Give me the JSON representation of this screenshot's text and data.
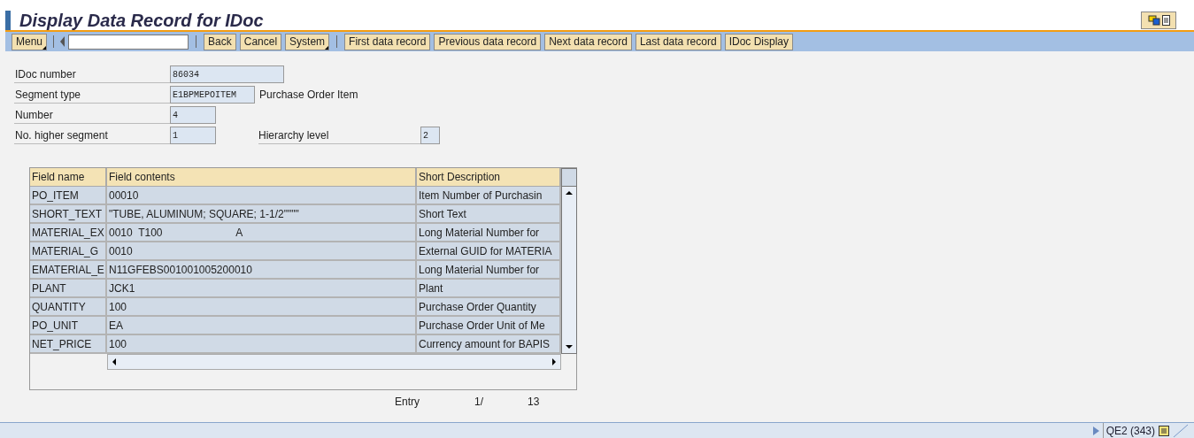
{
  "window": {
    "title": "Display Data Record for IDoc"
  },
  "toolbar": {
    "menu": "Menu",
    "buttons": [
      "Back",
      "Cancel",
      "System"
    ],
    "app_buttons": [
      "First data record",
      "Previous data record",
      "Next data record",
      "Last data record",
      "IDoc Display"
    ]
  },
  "header_fields": [
    {
      "label": "IDoc number",
      "value": "86034"
    },
    {
      "label": "Segment type",
      "value": "E1BPMEPOITEM",
      "description": "Purchase Order Item"
    },
    {
      "label": "Number",
      "value": "4"
    },
    {
      "label": "No. higher segment",
      "value": "1"
    }
  ],
  "hierarchy_level": {
    "label": "Hierarchy level",
    "value": "2"
  },
  "table": {
    "columns": [
      "Field name",
      "Field contents",
      "Short Description"
    ],
    "rows": [
      [
        "PO_ITEM",
        "00010",
        "Item Number of Purchasin"
      ],
      [
        "SHORT_TEXT",
        "\"TUBE, ALUMINUM; SQUARE; 1-1/2\"\"\"\"",
        "Short Text"
      ],
      [
        "MATERIAL_EX",
        "0010  T100                         A",
        "Long Material Number for"
      ],
      [
        "MATERIAL_G",
        "0010",
        "External GUID for MATERIA"
      ],
      [
        "EMATERIAL_E",
        "N11GFEBS001001005200010",
        "Long Material Number for"
      ],
      [
        "PLANT",
        "JCK1",
        "Plant"
      ],
      [
        "QUANTITY",
        "100",
        "Purchase Order Quantity"
      ],
      [
        "PO_UNIT",
        "EA",
        "Purchase Order Unit of Me"
      ],
      [
        "NET_PRICE",
        "100",
        "Currency amount for BAPIS"
      ]
    ]
  },
  "entry": {
    "label": "Entry",
    "current": "1/",
    "total": "13"
  },
  "status_bar": {
    "system": "QE2 (343)"
  }
}
